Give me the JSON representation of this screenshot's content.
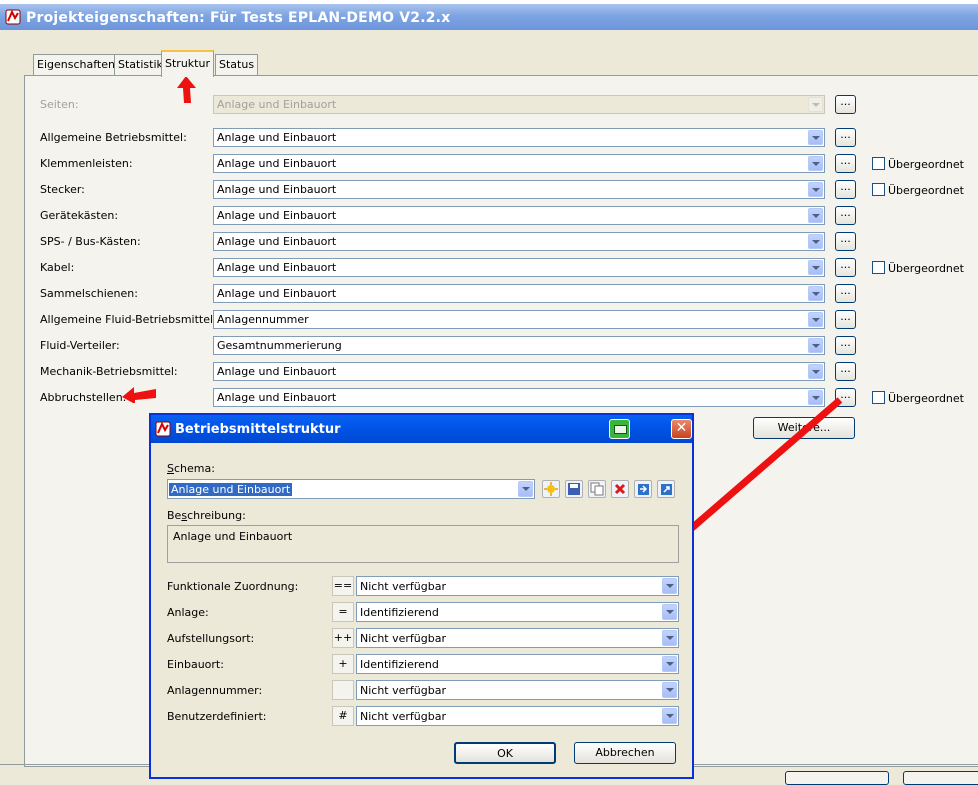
{
  "main_window": {
    "title": "Projekteigenschaften: Für Tests EPLAN-DEMO V2.2.x",
    "tabs": [
      "Eigenschaften",
      "Statistik",
      "Struktur",
      "Status"
    ],
    "active_tab": "Struktur",
    "rows": [
      {
        "label": "Seiten:",
        "value": "Anlage und Einbauort",
        "disabled": true,
        "checkbox": null
      },
      {
        "label": "Allgemeine Betriebsmittel:",
        "value": "Anlage und Einbauort",
        "disabled": false,
        "checkbox": null
      },
      {
        "label": "Klemmenleisten:",
        "value": "Anlage und Einbauort",
        "disabled": false,
        "checkbox": "Übergeordnet"
      },
      {
        "label": "Stecker:",
        "value": "Anlage und Einbauort",
        "disabled": false,
        "checkbox": "Übergeordnet"
      },
      {
        "label": "Gerätekästen:",
        "value": "Anlage und Einbauort",
        "disabled": false,
        "checkbox": null
      },
      {
        "label": "SPS- / Bus-Kästen:",
        "value": "Anlage und Einbauort",
        "disabled": false,
        "checkbox": null
      },
      {
        "label": "Kabel:",
        "value": "Anlage und Einbauort",
        "disabled": false,
        "checkbox": "Übergeordnet"
      },
      {
        "label": "Sammelschienen:",
        "value": "Anlage und Einbauort",
        "disabled": false,
        "checkbox": null
      },
      {
        "label": "Allgemeine Fluid-Betriebsmittel:",
        "value": "Anlagennummer",
        "disabled": false,
        "checkbox": null
      },
      {
        "label": "Fluid-Verteiler:",
        "value": "Gesamtnummerierung",
        "disabled": false,
        "checkbox": null
      },
      {
        "label": "Mechanik-Betriebsmittel:",
        "value": "Anlage und Einbauort",
        "disabled": false,
        "checkbox": null
      },
      {
        "label": "Abbruchstellen:",
        "value": "Anlage und Einbauort",
        "disabled": false,
        "checkbox": "Übergeordnet"
      }
    ],
    "dots_label": "...",
    "weitere_label": "Weitere..."
  },
  "dialog": {
    "title": "Betriebsmittelstruktur",
    "schema_label": "Schema:",
    "schema_value": "Anlage und Einbauort",
    "beschreibung_label": "Beschreibung:",
    "beschreibung_value": "Anlage und Einbauort",
    "rows": [
      {
        "label": "Funktionale Zuordnung:",
        "symbol": "==",
        "value": "Nicht verfügbar"
      },
      {
        "label": "Anlage:",
        "symbol": "=",
        "value": "Identifizierend"
      },
      {
        "label": "Aufstellungsort:",
        "symbol": "++",
        "value": "Nicht verfügbar"
      },
      {
        "label": "Einbauort:",
        "symbol": "+",
        "value": "Identifizierend"
      },
      {
        "label": "Anlagennummer:",
        "symbol": "",
        "value": "Nicht verfügbar"
      },
      {
        "label": "Benutzerdefiniert:",
        "symbol": "#",
        "value": "Nicht verfügbar"
      }
    ],
    "ok_label": "OK",
    "cancel_label": "Abbrechen"
  },
  "colors": {
    "annotation_arrow": "#ee1111",
    "dialog_title": "#0055ea",
    "main_title": "#7ea4e2"
  }
}
